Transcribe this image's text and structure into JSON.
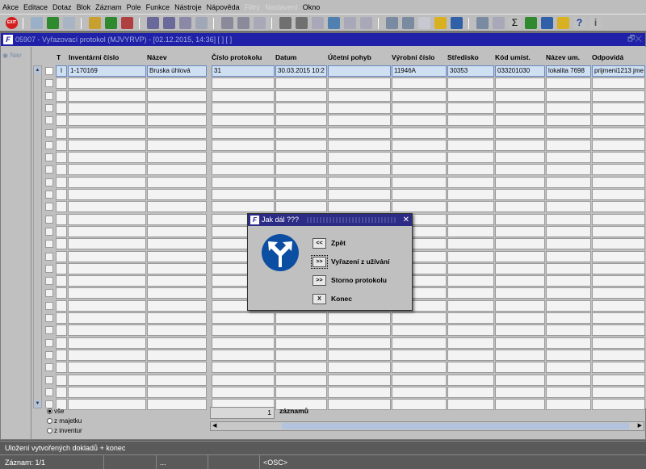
{
  "menu": [
    "Akce",
    "Editace",
    "Dotaz",
    "Blok",
    "Záznam",
    "Pole",
    "Funkce",
    "Nástroje",
    "Nápověda",
    "Filtry",
    "Nastavení",
    "Okno"
  ],
  "menu_disabled": [
    "Filtry",
    "Nastavení"
  ],
  "toolbar": {
    "exit_label": "EXIT"
  },
  "window": {
    "title": "05907 - Vyřazovací protokol (MJVYRVP) - [02.12.2015, 14:36] [ ] [ ]",
    "controls": "🗗✕"
  },
  "nav": {
    "label": "Nav"
  },
  "grid": {
    "headers": {
      "t": "T",
      "inventarni_cislo": "Inventární číslo",
      "nazev": "Název",
      "cislo_protokolu": "Číslo protokolu",
      "datum": "Datum",
      "ucetni_pohyb": "Účetní pohyb",
      "vyrobni_cislo": "Výrobní číslo",
      "stredisko": "Středisko",
      "kod_umist": "Kód umíst.",
      "nazev_um": "Název um.",
      "odpovida": "Odpovídá"
    },
    "row": {
      "t": "I",
      "inventarni_cislo": "1-170169",
      "nazev": "Bruska úhlová",
      "cislo_protokolu": "31",
      "datum": "30.03.2015 10:2",
      "ucetni_pohyb": "",
      "vyrobni_cislo": "11946A",
      "stredisko": "30353",
      "kod_umist": "033201030",
      "nazev_um": "lokalita 7698",
      "odpovida": "prijmeni1213 jme"
    }
  },
  "filters": {
    "options": [
      "vše",
      "z majetku",
      "z inventur"
    ],
    "selected": "vše"
  },
  "count": {
    "value": "1",
    "label": "záznamů"
  },
  "status": {
    "message": "Uložení vytvořených dokladů + konec",
    "record": "Záznam: 1/1",
    "ellipsis": "...",
    "mode": "<OSC>"
  },
  "dialog": {
    "title": "Jak dál ???",
    "close": "✕",
    "icon": "direction-arrows-icon",
    "options": [
      {
        "key": "<<",
        "label": "Zpět"
      },
      {
        "key": ">>",
        "label": "Vyřazení z užívání"
      },
      {
        "key": ">>",
        "label": "Storno protokolu"
      },
      {
        "key": "X",
        "label": "Konec"
      }
    ]
  },
  "colors": {
    "title_bar": "#2020a8",
    "dialog_title": "#2c2c86",
    "selected_row": "#cfe0f2",
    "sign_blue": "#0b4ea2"
  }
}
